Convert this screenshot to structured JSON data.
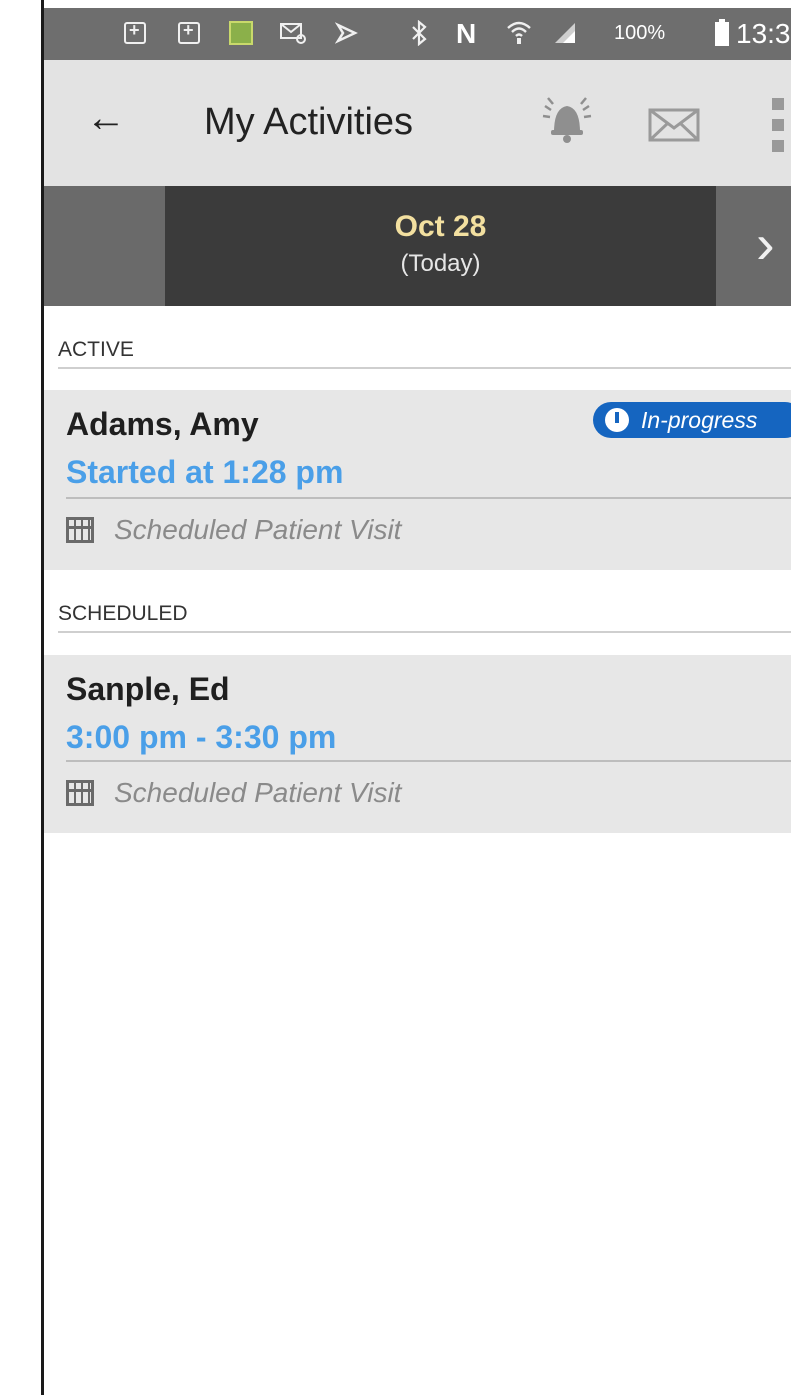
{
  "status_bar": {
    "battery_percent": "100%",
    "time": "13:3",
    "network_letter": "N"
  },
  "header": {
    "title": "My Activities",
    "back_icon": "arrow-left-icon",
    "bell_icon": "bell-icon",
    "mail_icon": "mail-icon",
    "menu_icon": "overflow-menu-icon"
  },
  "date_nav": {
    "date": "Oct 28",
    "relative": "(Today)",
    "next_icon": "chevron-right-icon"
  },
  "sections": {
    "active": {
      "label": "ACTIVE",
      "items": [
        {
          "name": "Adams, Amy",
          "time": "Started at 1:28 pm",
          "type": "Scheduled Patient Visit",
          "badge": "In-progress"
        }
      ]
    },
    "scheduled": {
      "label": "SCHEDULED",
      "items": [
        {
          "name": "Sanple, Ed",
          "time": "3:00 pm - 3:30 pm",
          "type": "Scheduled Patient Visit"
        }
      ]
    }
  },
  "colors": {
    "accent_blue": "#4a9fe8",
    "badge_blue": "#1565c0",
    "date_highlight": "#f3e0a0"
  }
}
